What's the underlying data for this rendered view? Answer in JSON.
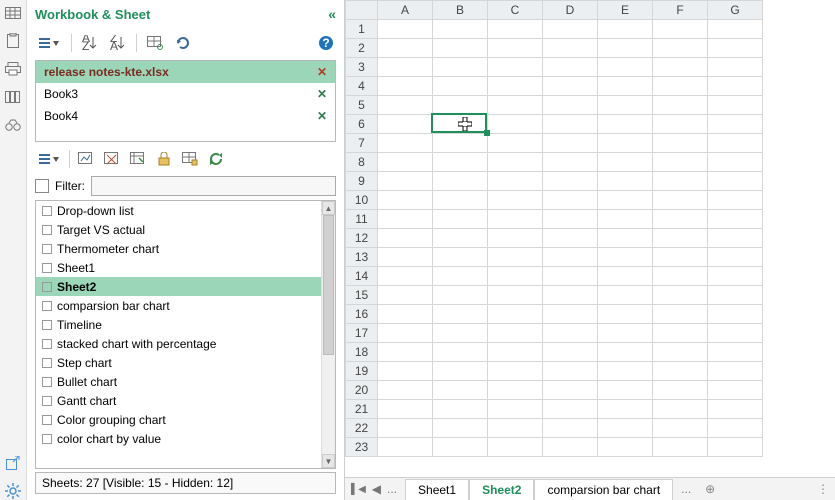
{
  "panel": {
    "title": "Workbook & Sheet",
    "collapse_glyph": "«"
  },
  "workbooks": [
    {
      "name": "release notes-kte.xlsx",
      "active": true
    },
    {
      "name": "Book3",
      "active": false
    },
    {
      "name": "Book4",
      "active": false
    }
  ],
  "filter": {
    "label": "Filter:",
    "value": ""
  },
  "sheets": [
    {
      "name": "Drop-down list",
      "active": false
    },
    {
      "name": "Target VS actual",
      "active": false
    },
    {
      "name": "Thermometer chart",
      "active": false
    },
    {
      "name": "Sheet1",
      "active": false
    },
    {
      "name": "Sheet2",
      "active": true
    },
    {
      "name": "comparsion bar chart",
      "active": false
    },
    {
      "name": "Timeline",
      "active": false
    },
    {
      "name": "stacked chart with percentage",
      "active": false
    },
    {
      "name": "Step chart",
      "active": false
    },
    {
      "name": "Bullet chart",
      "active": false
    },
    {
      "name": "Gantt chart",
      "active": false
    },
    {
      "name": "Color grouping chart",
      "active": false
    },
    {
      "name": "color chart by value",
      "active": false
    }
  ],
  "status": "Sheets: 27  [Visible: 15 - Hidden: 12]",
  "grid": {
    "columns": [
      "A",
      "B",
      "C",
      "D",
      "E",
      "F",
      "G"
    ],
    "row_start": 1,
    "row_end": 23,
    "selected_cell": "B6"
  },
  "tabs": {
    "left_overflow": "...",
    "visible": [
      "Sheet1",
      "Sheet2",
      "comparsion bar chart"
    ],
    "right_overflow": "...",
    "active": "Sheet2"
  },
  "icons": {
    "help": "?",
    "close": "✕",
    "nav_first": "⏮",
    "nav_prev": "◀",
    "add": "⊕",
    "more": "⋮"
  }
}
